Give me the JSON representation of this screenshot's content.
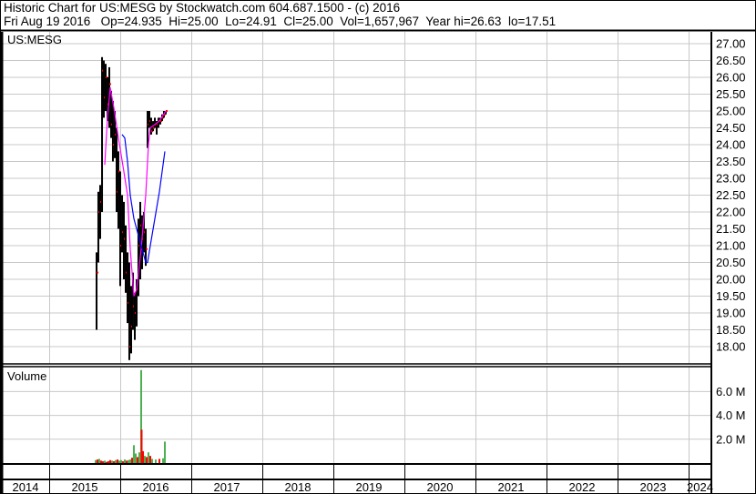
{
  "header": {
    "title": "Historic Chart for US:MESG by Stockwatch.com 604.687.1500 - (c) 2016",
    "quote": "Fri Aug 19 2016   Op=24.935  Hi=25.00  Lo=24.91  Cl=25.00  Vol=1,657,967  Year hi=26.63  lo=17.51"
  },
  "colors": {
    "bar": "#000000",
    "close_tick": "#ff0000",
    "ma_short": "#ff00ff",
    "ma_long": "#0000ff",
    "vol_up": "#4caf50",
    "vol_down": "#ff0000",
    "grid": "#c8c8c8"
  },
  "chart_data": {
    "type": "ohlc",
    "symbol_label": "US:MESG",
    "volume_label": "Volume",
    "price_ticks": [
      "27.00",
      "26.50",
      "26.00",
      "25.50",
      "25.00",
      "24.50",
      "24.00",
      "23.50",
      "23.00",
      "22.50",
      "22.00",
      "21.50",
      "21.00",
      "20.50",
      "20.00",
      "19.50",
      "19.00",
      "18.50",
      "18.00"
    ],
    "price_range": [
      17.45,
      27.0
    ],
    "volume_ticks": [
      "6.0 M",
      "4.0 M",
      "2.0 M"
    ],
    "volume_tick_values": [
      6,
      4,
      2
    ],
    "x_labels": [
      "2014",
      "2015",
      "2016",
      "2017",
      "2018",
      "2019",
      "2020",
      "2021",
      "2022",
      "2023",
      "2024"
    ],
    "x_range": [
      2014.31,
      2024.35
    ],
    "bars_format": [
      "year",
      "high",
      "low",
      "close"
    ],
    "bars": [
      [
        2015.667,
        20.8,
        18.5,
        20.2
      ],
      [
        2015.692,
        22.6,
        20.5,
        22.0
      ],
      [
        2015.718,
        22.8,
        21.2,
        22.3
      ],
      [
        2015.744,
        26.6,
        22.0,
        26.2
      ],
      [
        2015.769,
        26.5,
        24.8,
        25.4
      ],
      [
        2015.795,
        26.4,
        25.0,
        26.0
      ],
      [
        2015.821,
        26.0,
        24.7,
        25.2
      ],
      [
        2015.846,
        26.3,
        24.5,
        25.8
      ],
      [
        2015.872,
        25.6,
        24.2,
        24.6
      ],
      [
        2015.897,
        25.3,
        23.5,
        24.0
      ],
      [
        2015.923,
        25.0,
        23.6,
        24.3
      ],
      [
        2015.949,
        24.5,
        22.0,
        22.6
      ],
      [
        2015.974,
        23.8,
        21.5,
        23.2
      ],
      [
        2016.0,
        23.2,
        19.8,
        21.0
      ],
      [
        2016.026,
        22.5,
        20.8,
        21.4
      ],
      [
        2016.051,
        22.3,
        20.0,
        21.2
      ],
      [
        2016.077,
        21.6,
        19.6,
        20.2
      ],
      [
        2016.103,
        20.8,
        18.7,
        19.3
      ],
      [
        2016.128,
        20.5,
        17.6,
        18.0
      ],
      [
        2016.154,
        19.8,
        17.8,
        18.6
      ],
      [
        2016.179,
        20.2,
        18.5,
        19.2
      ],
      [
        2016.205,
        19.6,
        18.2,
        19.0
      ],
      [
        2016.231,
        20.0,
        18.6,
        19.7
      ],
      [
        2016.256,
        21.8,
        19.5,
        21.0
      ],
      [
        2016.282,
        22.3,
        20.0,
        21.6
      ],
      [
        2016.308,
        21.9,
        20.3,
        21.2
      ],
      [
        2016.333,
        22.0,
        20.8,
        21.4
      ],
      [
        2016.359,
        21.5,
        20.4,
        20.9
      ],
      [
        2016.385,
        25.0,
        23.9,
        24.6
      ],
      [
        2016.41,
        25.0,
        24.5,
        24.7
      ],
      [
        2016.436,
        24.8,
        24.3,
        24.4
      ],
      [
        2016.462,
        24.7,
        24.4,
        24.5
      ],
      [
        2016.487,
        24.8,
        24.5,
        24.6
      ],
      [
        2016.513,
        24.7,
        24.3,
        24.6
      ],
      [
        2016.538,
        24.8,
        24.5,
        24.7
      ],
      [
        2016.564,
        24.8,
        24.6,
        24.7
      ],
      [
        2016.59,
        24.9,
        24.7,
        24.8
      ],
      [
        2016.615,
        25.0,
        24.8,
        24.9
      ],
      [
        2016.641,
        25.0,
        24.9,
        25.0
      ]
    ],
    "ma_short": [
      [
        2015.782,
        23.4
      ],
      [
        2015.821,
        24.8
      ],
      [
        2015.859,
        25.7
      ],
      [
        2015.91,
        25.1
      ],
      [
        2015.974,
        24.2
      ],
      [
        2016.051,
        23.2
      ],
      [
        2016.103,
        22.5
      ],
      [
        2016.141,
        20.9
      ],
      [
        2016.192,
        19.5
      ],
      [
        2016.231,
        19.7
      ],
      [
        2016.295,
        20.9
      ],
      [
        2016.359,
        22.5
      ],
      [
        2016.397,
        24.0
      ],
      [
        2016.423,
        24.5
      ],
      [
        2016.487,
        24.6
      ],
      [
        2016.551,
        24.7
      ],
      [
        2016.641,
        25.0
      ]
    ],
    "ma_long": [
      [
        2016.026,
        24.3
      ],
      [
        2016.064,
        24.2
      ],
      [
        2016.103,
        23.5
      ],
      [
        2016.141,
        22.5
      ],
      [
        2016.192,
        21.8
      ],
      [
        2016.231,
        21.5
      ],
      [
        2016.269,
        21.2
      ],
      [
        2016.321,
        20.8
      ],
      [
        2016.359,
        20.5
      ],
      [
        2016.385,
        20.5
      ],
      [
        2016.423,
        21.0
      ],
      [
        2016.487,
        21.8
      ],
      [
        2016.551,
        22.6
      ],
      [
        2016.628,
        23.8
      ]
    ],
    "volume_millions": [
      [
        2015.654,
        0.25,
        "up"
      ],
      [
        2015.68,
        0.3,
        "down"
      ],
      [
        2015.705,
        0.35,
        "up"
      ],
      [
        2015.731,
        0.2,
        "down"
      ],
      [
        2015.756,
        0.15,
        "down"
      ],
      [
        2015.782,
        0.2,
        "up"
      ],
      [
        2015.808,
        0.1,
        "down"
      ],
      [
        2015.833,
        0.15,
        "down"
      ],
      [
        2015.859,
        0.25,
        "down"
      ],
      [
        2015.885,
        0.2,
        "up"
      ],
      [
        2015.91,
        0.15,
        "down"
      ],
      [
        2015.936,
        0.25,
        "up"
      ],
      [
        2015.962,
        0.3,
        "down"
      ],
      [
        2015.987,
        0.2,
        "up"
      ],
      [
        2016.013,
        0.25,
        "up"
      ],
      [
        2016.038,
        0.15,
        "down"
      ],
      [
        2016.064,
        0.3,
        "up"
      ],
      [
        2016.09,
        0.2,
        "down"
      ],
      [
        2016.115,
        0.25,
        "up"
      ],
      [
        2016.141,
        0.3,
        "up"
      ],
      [
        2016.167,
        0.45,
        "down"
      ],
      [
        2016.192,
        1.5,
        "up"
      ],
      [
        2016.218,
        0.8,
        "up"
      ],
      [
        2016.244,
        0.5,
        "down"
      ],
      [
        2016.269,
        0.9,
        "up"
      ],
      [
        2016.295,
        7.8,
        "up"
      ],
      [
        2016.301,
        2.8,
        "down"
      ],
      [
        2016.321,
        1.0,
        "down"
      ],
      [
        2016.346,
        0.6,
        "up"
      ],
      [
        2016.372,
        0.5,
        "down"
      ],
      [
        2016.397,
        0.9,
        "up"
      ],
      [
        2016.423,
        0.6,
        "down"
      ],
      [
        2016.449,
        0.35,
        "up"
      ],
      [
        2016.5,
        0.3,
        "up"
      ],
      [
        2016.551,
        0.35,
        "down"
      ],
      [
        2016.603,
        0.4,
        "up"
      ],
      [
        2016.628,
        1.8,
        "up"
      ]
    ]
  }
}
